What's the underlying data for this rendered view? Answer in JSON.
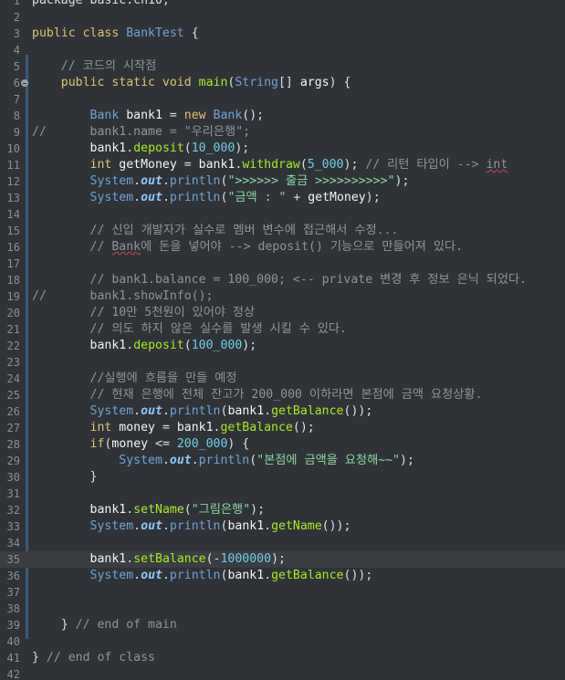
{
  "editor": {
    "language": "java",
    "current_line": 35,
    "lines": [
      {
        "n": "1",
        "fold": false,
        "tokens": [
          {
            "t": "package basic.ch10;",
            "c": "plain"
          }
        ]
      },
      {
        "n": "2",
        "fold": false,
        "tokens": []
      },
      {
        "n": "3",
        "fold": false,
        "tokens": [
          {
            "t": "public ",
            "c": "kw"
          },
          {
            "t": "class ",
            "c": "kw"
          },
          {
            "t": "BankTest",
            "c": "ty"
          },
          {
            "t": " {",
            "c": "plain"
          }
        ]
      },
      {
        "n": "4",
        "fold": false,
        "tokens": []
      },
      {
        "n": "5",
        "fold": false,
        "tokens": [
          {
            "t": "    // 코드의 시작점",
            "c": "cm"
          }
        ]
      },
      {
        "n": "6",
        "fold": true,
        "tokens": [
          {
            "t": "    ",
            "c": "plain"
          },
          {
            "t": "public ",
            "c": "kw"
          },
          {
            "t": "static ",
            "c": "kw"
          },
          {
            "t": "void ",
            "c": "kw"
          },
          {
            "t": "main",
            "c": "fn"
          },
          {
            "t": "(",
            "c": "plain"
          },
          {
            "t": "String",
            "c": "ty"
          },
          {
            "t": "[] ",
            "c": "plain"
          },
          {
            "t": "args",
            "c": "var"
          },
          {
            "t": ") {",
            "c": "plain"
          }
        ]
      },
      {
        "n": "7",
        "fold": false,
        "tokens": []
      },
      {
        "n": "8",
        "fold": false,
        "tokens": [
          {
            "t": "        ",
            "c": "plain"
          },
          {
            "t": "Bank ",
            "c": "ty"
          },
          {
            "t": "bank1",
            "c": "var"
          },
          {
            "t": " = ",
            "c": "plain"
          },
          {
            "t": "new ",
            "c": "kw"
          },
          {
            "t": "Bank",
            "c": "ty"
          },
          {
            "t": "();",
            "c": "plain"
          }
        ]
      },
      {
        "n": "9",
        "fold": false,
        "tokens": [
          {
            "t": "//      bank1.name = \"우리은행\";",
            "c": "cm"
          }
        ]
      },
      {
        "n": "10",
        "fold": false,
        "tokens": [
          {
            "t": "        ",
            "c": "plain"
          },
          {
            "t": "bank1",
            "c": "var"
          },
          {
            "t": ".",
            "c": "plain"
          },
          {
            "t": "deposit",
            "c": "fn"
          },
          {
            "t": "(",
            "c": "plain"
          },
          {
            "t": "10_000",
            "c": "num"
          },
          {
            "t": ");",
            "c": "plain"
          }
        ]
      },
      {
        "n": "11",
        "fold": false,
        "tokens": [
          {
            "t": "        ",
            "c": "plain"
          },
          {
            "t": "int ",
            "c": "kw"
          },
          {
            "t": "getMoney",
            "c": "var"
          },
          {
            "t": " = ",
            "c": "plain"
          },
          {
            "t": "bank1",
            "c": "var"
          },
          {
            "t": ".",
            "c": "plain"
          },
          {
            "t": "withdraw",
            "c": "fn"
          },
          {
            "t": "(",
            "c": "plain"
          },
          {
            "t": "5_000",
            "c": "num"
          },
          {
            "t": "); ",
            "c": "plain"
          },
          {
            "t": "// 리턴 타입이 --> ",
            "c": "cm"
          },
          {
            "t": "int",
            "c": "cm err"
          }
        ]
      },
      {
        "n": "12",
        "fold": false,
        "tokens": [
          {
            "t": "        ",
            "c": "plain"
          },
          {
            "t": "System",
            "c": "ty"
          },
          {
            "t": ".",
            "c": "plain"
          },
          {
            "t": "out",
            "c": "fld"
          },
          {
            "t": ".",
            "c": "plain"
          },
          {
            "t": "println",
            "c": "ty"
          },
          {
            "t": "(",
            "c": "plain"
          },
          {
            "t": "\">>>>>> 출금 >>>>>>>>>>\"",
            "c": "str"
          },
          {
            "t": ");",
            "c": "plain"
          }
        ]
      },
      {
        "n": "13",
        "fold": false,
        "tokens": [
          {
            "t": "        ",
            "c": "plain"
          },
          {
            "t": "System",
            "c": "ty"
          },
          {
            "t": ".",
            "c": "plain"
          },
          {
            "t": "out",
            "c": "fld"
          },
          {
            "t": ".",
            "c": "plain"
          },
          {
            "t": "println",
            "c": "ty"
          },
          {
            "t": "(",
            "c": "plain"
          },
          {
            "t": "\"금액 : \"",
            "c": "str"
          },
          {
            "t": " + ",
            "c": "plain"
          },
          {
            "t": "getMoney",
            "c": "var"
          },
          {
            "t": ");",
            "c": "plain"
          }
        ]
      },
      {
        "n": "14",
        "fold": false,
        "tokens": []
      },
      {
        "n": "15",
        "fold": false,
        "tokens": [
          {
            "t": "        // 신입 개발자가 실수로 멤버 변수에 접근해서 수정...",
            "c": "cm"
          }
        ]
      },
      {
        "n": "16",
        "fold": false,
        "tokens": [
          {
            "t": "        // ",
            "c": "cm"
          },
          {
            "t": "Bank",
            "c": "cm err"
          },
          {
            "t": "에 돈을 넣어야 --> deposit() 기능으로 만들어져 있다.",
            "c": "cm"
          }
        ]
      },
      {
        "n": "17",
        "fold": false,
        "tokens": []
      },
      {
        "n": "18",
        "fold": false,
        "tokens": [
          {
            "t": "        // bank1.balance = 100_000; <-- private 변경 후 정보 은닉 되었다.",
            "c": "cm"
          }
        ]
      },
      {
        "n": "19",
        "fold": false,
        "tokens": [
          {
            "t": "//      bank1.showInfo();",
            "c": "cm"
          }
        ]
      },
      {
        "n": "20",
        "fold": false,
        "tokens": [
          {
            "t": "        // 10만 5천원이 있어야 정상",
            "c": "cm"
          }
        ]
      },
      {
        "n": "21",
        "fold": false,
        "tokens": [
          {
            "t": "        // 의도 하지 않은 실수를 발생 시킬 수 있다.",
            "c": "cm"
          }
        ]
      },
      {
        "n": "22",
        "fold": false,
        "tokens": [
          {
            "t": "        ",
            "c": "plain"
          },
          {
            "t": "bank1",
            "c": "var"
          },
          {
            "t": ".",
            "c": "plain"
          },
          {
            "t": "deposit",
            "c": "fn"
          },
          {
            "t": "(",
            "c": "plain"
          },
          {
            "t": "100_000",
            "c": "num"
          },
          {
            "t": ");",
            "c": "plain"
          }
        ]
      },
      {
        "n": "23",
        "fold": false,
        "tokens": []
      },
      {
        "n": "24",
        "fold": false,
        "tokens": [
          {
            "t": "        //실행에 흐름을 만들 예정",
            "c": "cm"
          }
        ]
      },
      {
        "n": "25",
        "fold": false,
        "tokens": [
          {
            "t": "        // 현재 은행에 전체 잔고가 200_000 이하라면 본점에 금액 요청상황.",
            "c": "cm"
          }
        ]
      },
      {
        "n": "26",
        "fold": false,
        "tokens": [
          {
            "t": "        ",
            "c": "plain"
          },
          {
            "t": "System",
            "c": "ty"
          },
          {
            "t": ".",
            "c": "plain"
          },
          {
            "t": "out",
            "c": "fld"
          },
          {
            "t": ".",
            "c": "plain"
          },
          {
            "t": "println",
            "c": "ty"
          },
          {
            "t": "(",
            "c": "plain"
          },
          {
            "t": "bank1",
            "c": "var"
          },
          {
            "t": ".",
            "c": "plain"
          },
          {
            "t": "getBalance",
            "c": "fn"
          },
          {
            "t": "());",
            "c": "plain"
          }
        ]
      },
      {
        "n": "27",
        "fold": false,
        "tokens": [
          {
            "t": "        ",
            "c": "plain"
          },
          {
            "t": "int ",
            "c": "kw"
          },
          {
            "t": "money",
            "c": "var"
          },
          {
            "t": " = ",
            "c": "plain"
          },
          {
            "t": "bank1",
            "c": "var"
          },
          {
            "t": ".",
            "c": "plain"
          },
          {
            "t": "getBalance",
            "c": "fn"
          },
          {
            "t": "();",
            "c": "plain"
          }
        ]
      },
      {
        "n": "28",
        "fold": false,
        "tokens": [
          {
            "t": "        ",
            "c": "plain"
          },
          {
            "t": "if",
            "c": "kw"
          },
          {
            "t": "(",
            "c": "plain"
          },
          {
            "t": "money",
            "c": "var"
          },
          {
            "t": " <= ",
            "c": "plain"
          },
          {
            "t": "200_000",
            "c": "num"
          },
          {
            "t": ") {",
            "c": "plain"
          }
        ]
      },
      {
        "n": "29",
        "fold": false,
        "tokens": [
          {
            "t": "            ",
            "c": "plain"
          },
          {
            "t": "System",
            "c": "ty"
          },
          {
            "t": ".",
            "c": "plain"
          },
          {
            "t": "out",
            "c": "fld"
          },
          {
            "t": ".",
            "c": "plain"
          },
          {
            "t": "println",
            "c": "ty"
          },
          {
            "t": "(",
            "c": "plain"
          },
          {
            "t": "\"본점에 금액을 요청해~~\"",
            "c": "str"
          },
          {
            "t": ");",
            "c": "plain"
          }
        ]
      },
      {
        "n": "30",
        "fold": false,
        "tokens": [
          {
            "t": "        }",
            "c": "plain"
          }
        ]
      },
      {
        "n": "31",
        "fold": false,
        "tokens": []
      },
      {
        "n": "32",
        "fold": false,
        "tokens": [
          {
            "t": "        ",
            "c": "plain"
          },
          {
            "t": "bank1",
            "c": "var"
          },
          {
            "t": ".",
            "c": "plain"
          },
          {
            "t": "setName",
            "c": "fn"
          },
          {
            "t": "(",
            "c": "plain"
          },
          {
            "t": "\"그림은행\"",
            "c": "str"
          },
          {
            "t": ");",
            "c": "plain"
          }
        ]
      },
      {
        "n": "33",
        "fold": false,
        "tokens": [
          {
            "t": "        ",
            "c": "plain"
          },
          {
            "t": "System",
            "c": "ty"
          },
          {
            "t": ".",
            "c": "plain"
          },
          {
            "t": "out",
            "c": "fld"
          },
          {
            "t": ".",
            "c": "plain"
          },
          {
            "t": "println",
            "c": "ty"
          },
          {
            "t": "(",
            "c": "plain"
          },
          {
            "t": "bank1",
            "c": "var"
          },
          {
            "t": ".",
            "c": "plain"
          },
          {
            "t": "getName",
            "c": "fn"
          },
          {
            "t": "());",
            "c": "plain"
          }
        ]
      },
      {
        "n": "34",
        "fold": false,
        "tokens": []
      },
      {
        "n": "35",
        "fold": false,
        "tokens": [
          {
            "t": "        ",
            "c": "plain"
          },
          {
            "t": "bank1",
            "c": "var"
          },
          {
            "t": ".",
            "c": "plain"
          },
          {
            "t": "setBalance",
            "c": "fn"
          },
          {
            "t": "(-",
            "c": "plain"
          },
          {
            "t": "1000000",
            "c": "num"
          },
          {
            "t": ");",
            "c": "plain"
          }
        ]
      },
      {
        "n": "36",
        "fold": false,
        "tokens": [
          {
            "t": "        ",
            "c": "plain"
          },
          {
            "t": "System",
            "c": "ty"
          },
          {
            "t": ".",
            "c": "plain"
          },
          {
            "t": "out",
            "c": "fld"
          },
          {
            "t": ".",
            "c": "plain"
          },
          {
            "t": "println",
            "c": "ty"
          },
          {
            "t": "(",
            "c": "plain"
          },
          {
            "t": "bank1",
            "c": "var"
          },
          {
            "t": ".",
            "c": "plain"
          },
          {
            "t": "getBalance",
            "c": "fn"
          },
          {
            "t": "());",
            "c": "plain"
          }
        ]
      },
      {
        "n": "37",
        "fold": false,
        "tokens": []
      },
      {
        "n": "38",
        "fold": false,
        "tokens": []
      },
      {
        "n": "39",
        "fold": false,
        "tokens": [
          {
            "t": "    } ",
            "c": "plain"
          },
          {
            "t": "// end of main",
            "c": "cm"
          }
        ]
      },
      {
        "n": "40",
        "fold": false,
        "tokens": []
      },
      {
        "n": "41",
        "fold": false,
        "tokens": [
          {
            "t": "} ",
            "c": "plain"
          },
          {
            "t": "// end of class",
            "c": "cm"
          }
        ]
      },
      {
        "n": "42",
        "fold": false,
        "tokens": []
      }
    ]
  }
}
